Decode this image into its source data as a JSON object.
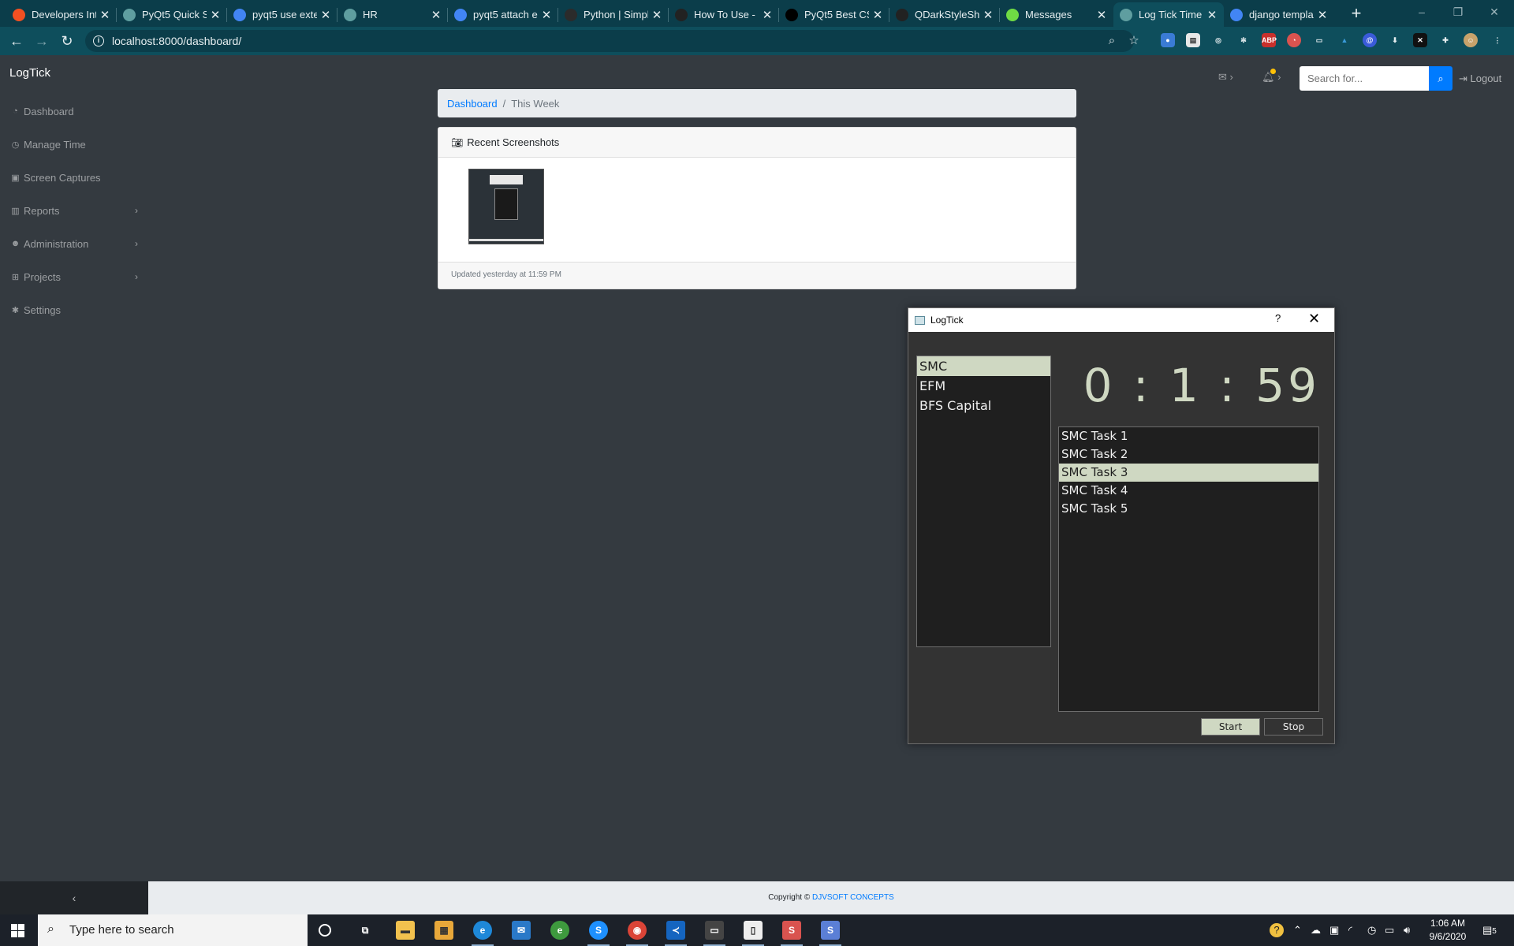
{
  "browser": {
    "tabs": [
      {
        "title": "Developers Inte",
        "favicon": "microsoft-icon",
        "color": "#f25022"
      },
      {
        "title": "PyQt5 Quick St",
        "favicon": "globe-icon",
        "color": "#5f9ea0"
      },
      {
        "title": "pyqt5 use exte",
        "favicon": "google-icon",
        "color": "#4285f4"
      },
      {
        "title": "HR",
        "favicon": "globe-icon",
        "color": "#5f9ea0"
      },
      {
        "title": "pyqt5 attach e",
        "favicon": "google-icon",
        "color": "#4285f4"
      },
      {
        "title": "Python | Simpl",
        "favicon": "bug-icon",
        "color": "#2b2b2b"
      },
      {
        "title": "How To Use - I",
        "favicon": "github-icon",
        "color": "#222"
      },
      {
        "title": "PyQt5 Best CS",
        "favicon": "medium-icon",
        "color": "#000"
      },
      {
        "title": "QDarkStyleShe",
        "favicon": "github-icon",
        "color": "#222"
      },
      {
        "title": "Messages",
        "favicon": "upwork-icon",
        "color": "#6fda44"
      },
      {
        "title": "Log Tick Time",
        "favicon": "globe-icon",
        "color": "#5f9ea0"
      },
      {
        "title": "django templa",
        "favicon": "google-icon",
        "color": "#4285f4"
      }
    ],
    "active_tab": 10,
    "url": "localhost:8000/dashboard/"
  },
  "web": {
    "brand": "LogTick",
    "sidebar": [
      {
        "label": "Dashboard",
        "icon": "dashboard-icon",
        "has_children": false
      },
      {
        "label": "Manage Time",
        "icon": "clock-icon",
        "has_children": false
      },
      {
        "label": "Screen Captures",
        "icon": "camera-icon",
        "has_children": false
      },
      {
        "label": "Reports",
        "icon": "bar-chart-icon",
        "has_children": true
      },
      {
        "label": "Administration",
        "icon": "users-icon",
        "has_children": true
      },
      {
        "label": "Projects",
        "icon": "sitemap-icon",
        "has_children": true
      },
      {
        "label": "Settings",
        "icon": "gear-icon",
        "has_children": false
      }
    ],
    "search": {
      "placeholder": "Search for..."
    },
    "logout_label": "Logout",
    "breadcrumb": {
      "link": "Dashboard",
      "current": "This Week"
    },
    "card": {
      "title": "Recent Screenshots",
      "footer": "Updated yesterday at 11:59 PM"
    },
    "footer": {
      "prefix": "Copyright ©",
      "company": "DJVSOFT CONCEPTS"
    }
  },
  "dialog": {
    "title": "LogTick",
    "help": "?",
    "projects": [
      "SMC",
      "EFM",
      "BFS Capital"
    ],
    "selected_project": 0,
    "timer": "0 : 1 : 59",
    "tasks": [
      "SMC Task 1",
      "SMC Task 2",
      "SMC Task 3",
      "SMC Task 4",
      "SMC Task 5"
    ],
    "selected_task": 2,
    "start_label": "Start",
    "stop_label": "Stop"
  },
  "taskbar": {
    "search_placeholder": "Type here to search",
    "time": "1:06 AM",
    "date": "9/6/2020",
    "notification_count": "5"
  }
}
